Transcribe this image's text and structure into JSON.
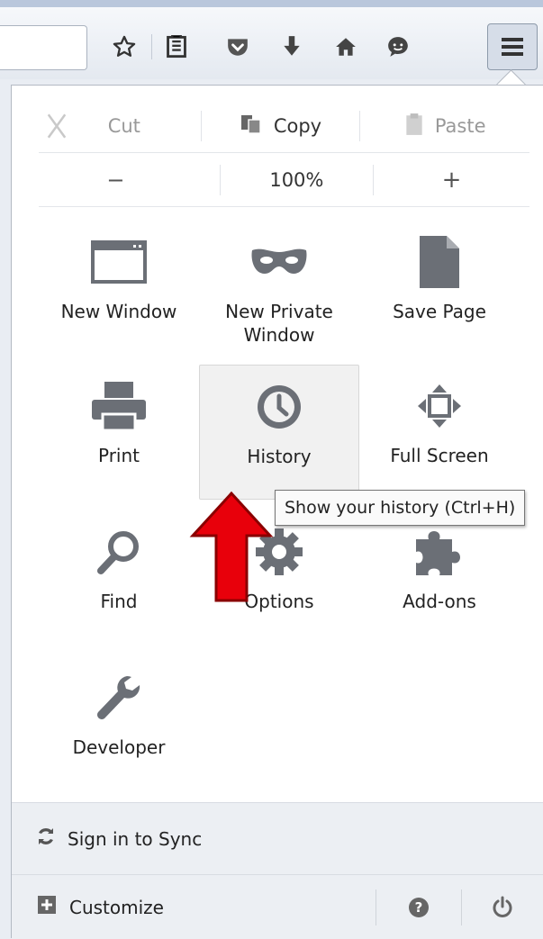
{
  "toolbar": {
    "icons": [
      "bookmark-star-icon",
      "reading-list-icon",
      "pocket-icon",
      "download-icon",
      "home-icon",
      "chat-icon"
    ],
    "menu_icon": "hamburger-menu-icon"
  },
  "edit": {
    "cut": "Cut",
    "copy": "Copy",
    "paste": "Paste"
  },
  "zoom": {
    "minus": "−",
    "level": "100%",
    "plus": "+"
  },
  "tiles": [
    {
      "label": "New Window",
      "icon": "window-icon"
    },
    {
      "label": "New Private Window",
      "icon": "mask-icon"
    },
    {
      "label": "Save Page",
      "icon": "page-icon"
    },
    {
      "label": "Print",
      "icon": "printer-icon"
    },
    {
      "label": "History",
      "icon": "clock-icon"
    },
    {
      "label": "Full Screen",
      "icon": "fullscreen-icon"
    },
    {
      "label": "Find",
      "icon": "magnifier-icon"
    },
    {
      "label": "Options",
      "icon": "gear-icon"
    },
    {
      "label": "Add-ons",
      "icon": "puzzle-icon"
    },
    {
      "label": "Developer",
      "icon": "wrench-icon"
    }
  ],
  "tooltip": "Show your history (Ctrl+H)",
  "footer": {
    "sync": "Sign in to Sync",
    "customize": "Customize"
  },
  "colors": {
    "icon_gray": "#6b6f76",
    "annotation_arrow": "#e8000b"
  }
}
